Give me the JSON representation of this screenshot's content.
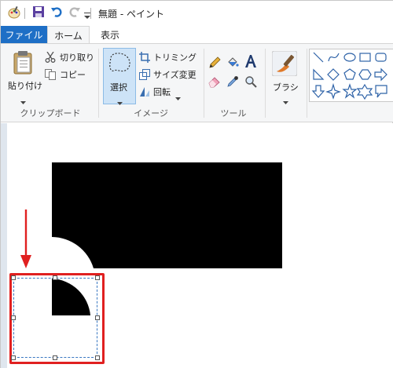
{
  "window": {
    "title": "無題 - ペイント"
  },
  "tabs": {
    "file": "ファイル",
    "home": "ホーム",
    "view": "表示"
  },
  "clipboard": {
    "paste": "貼り付け",
    "cut": "切り取り",
    "copy": "コピー",
    "group_label": "クリップボード"
  },
  "image": {
    "select": "選択",
    "crop": "トリミング",
    "resize": "サイズ変更",
    "rotate": "回転",
    "group_label": "イメージ"
  },
  "tools": {
    "group_label": "ツール"
  },
  "brushes": {
    "label": "ブラシ"
  },
  "colors": {
    "accent": "#1e6fc6",
    "annotation": "#e02020",
    "selection": "#3a78c2"
  }
}
